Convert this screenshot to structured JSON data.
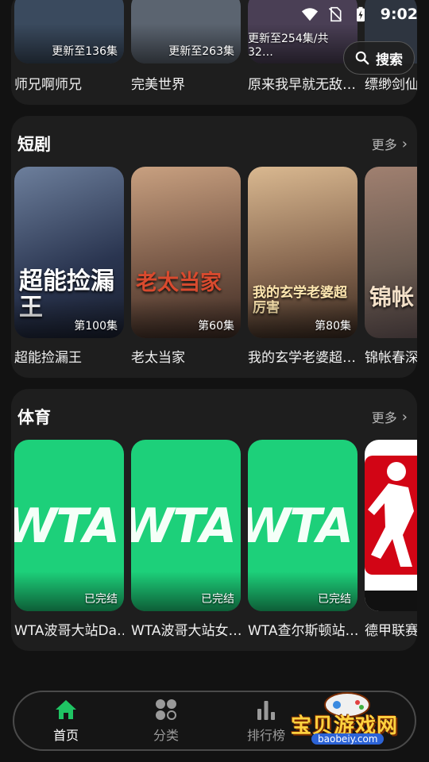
{
  "status_bar": {
    "time": "9:02"
  },
  "search": {
    "label": "搜索"
  },
  "top_row": {
    "items": [
      {
        "title": "师兄啊师兄",
        "badge": "更新至136集",
        "bg": "#3a4a5e"
      },
      {
        "title": "完美世界",
        "badge": "更新至263集",
        "bg": "#5b6470"
      },
      {
        "title": "原来我早就无敌…",
        "badge": "更新至254集/共32…",
        "bg": "#4a3f55"
      },
      {
        "title": "缥缈剑仙",
        "badge": "",
        "bg": "#2e3540"
      }
    ]
  },
  "short_drama": {
    "title": "短剧",
    "more": "更多",
    "items": [
      {
        "title": "超能捡漏王",
        "badge": "第100集",
        "poster": "超能捡漏王",
        "bg": "#3c4a66"
      },
      {
        "title": "老太当家",
        "badge": "第60集",
        "poster": "老太当家",
        "bg": "#7a5a48"
      },
      {
        "title": "我的玄学老婆超…",
        "badge": "第80集",
        "poster": "我的玄学老婆超厉害",
        "bg": "#8a6a52"
      },
      {
        "title": "锦帐春深",
        "badge": "",
        "poster": "锦帐",
        "bg": "#6a5a50"
      }
    ]
  },
  "sports": {
    "title": "体育",
    "more": "更多",
    "items": [
      {
        "title": "WTA波哥大站Da…",
        "badge": "已完结",
        "logo": "WTA"
      },
      {
        "title": "WTA波哥大站女…",
        "badge": "已完结",
        "logo": "WTA"
      },
      {
        "title": "WTA查尔斯顿站…",
        "badge": "已完结",
        "logo": "WTA"
      },
      {
        "title": "德甲联赛",
        "badge": "",
        "logo": ""
      }
    ]
  },
  "nav": {
    "items": [
      {
        "label": "首页",
        "active": true
      },
      {
        "label": "分类",
        "active": false
      },
      {
        "label": "排行榜",
        "active": false
      }
    ]
  },
  "watermark": {
    "text": "宝贝游戏网",
    "url": "baobeiy.com"
  },
  "colors": {
    "accent": "#1fc463",
    "background": "#121212",
    "card": "#1e1e1e",
    "wta_green": "#1dd07a"
  }
}
